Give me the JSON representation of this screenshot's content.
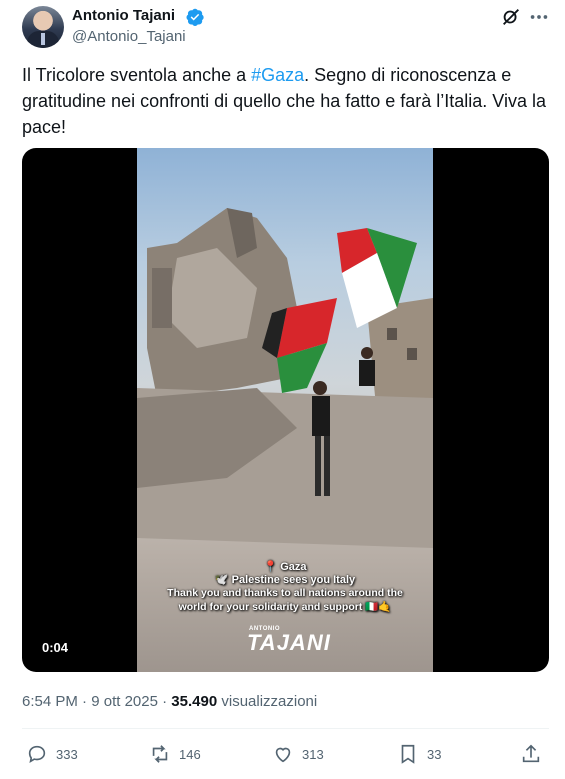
{
  "author": {
    "name": "Antonio Tajani",
    "handle": "@Antonio_Tajani",
    "verified": true,
    "verified_color": "#1d9bf0"
  },
  "header_icons": [
    "grok-icon",
    "more-icon"
  ],
  "tweet": {
    "text_before": "Il Tricolore sventola anche a ",
    "hashtag": "#Gaza",
    "text_after": ". Segno di riconoscenza e gratitudine nei confronti di quello che ha fatto e farà l’Italia. Viva la pace!"
  },
  "media": {
    "duration": "0:04",
    "caption_line1": "📍 Gaza",
    "caption_line2": "🕊️ Palestine sees you Italy",
    "caption_line3": "Thank you and thanks to all nations around the",
    "caption_line4": "world for your solidarity and support 🇮🇹🤙",
    "logo_small": "ANTONIO",
    "logo_big": "TAJANI"
  },
  "meta": {
    "time": "6:54 PM",
    "separator": " · ",
    "date": "9 ott 2025",
    "views": "35.490",
    "views_label": "visualizzazioni"
  },
  "actions": {
    "replies": "333",
    "reposts": "146",
    "likes": "313",
    "bookmarks": "33"
  },
  "colors": {
    "text": "#0f1419",
    "secondary": "#536471",
    "accent": "#1d9bf0"
  }
}
